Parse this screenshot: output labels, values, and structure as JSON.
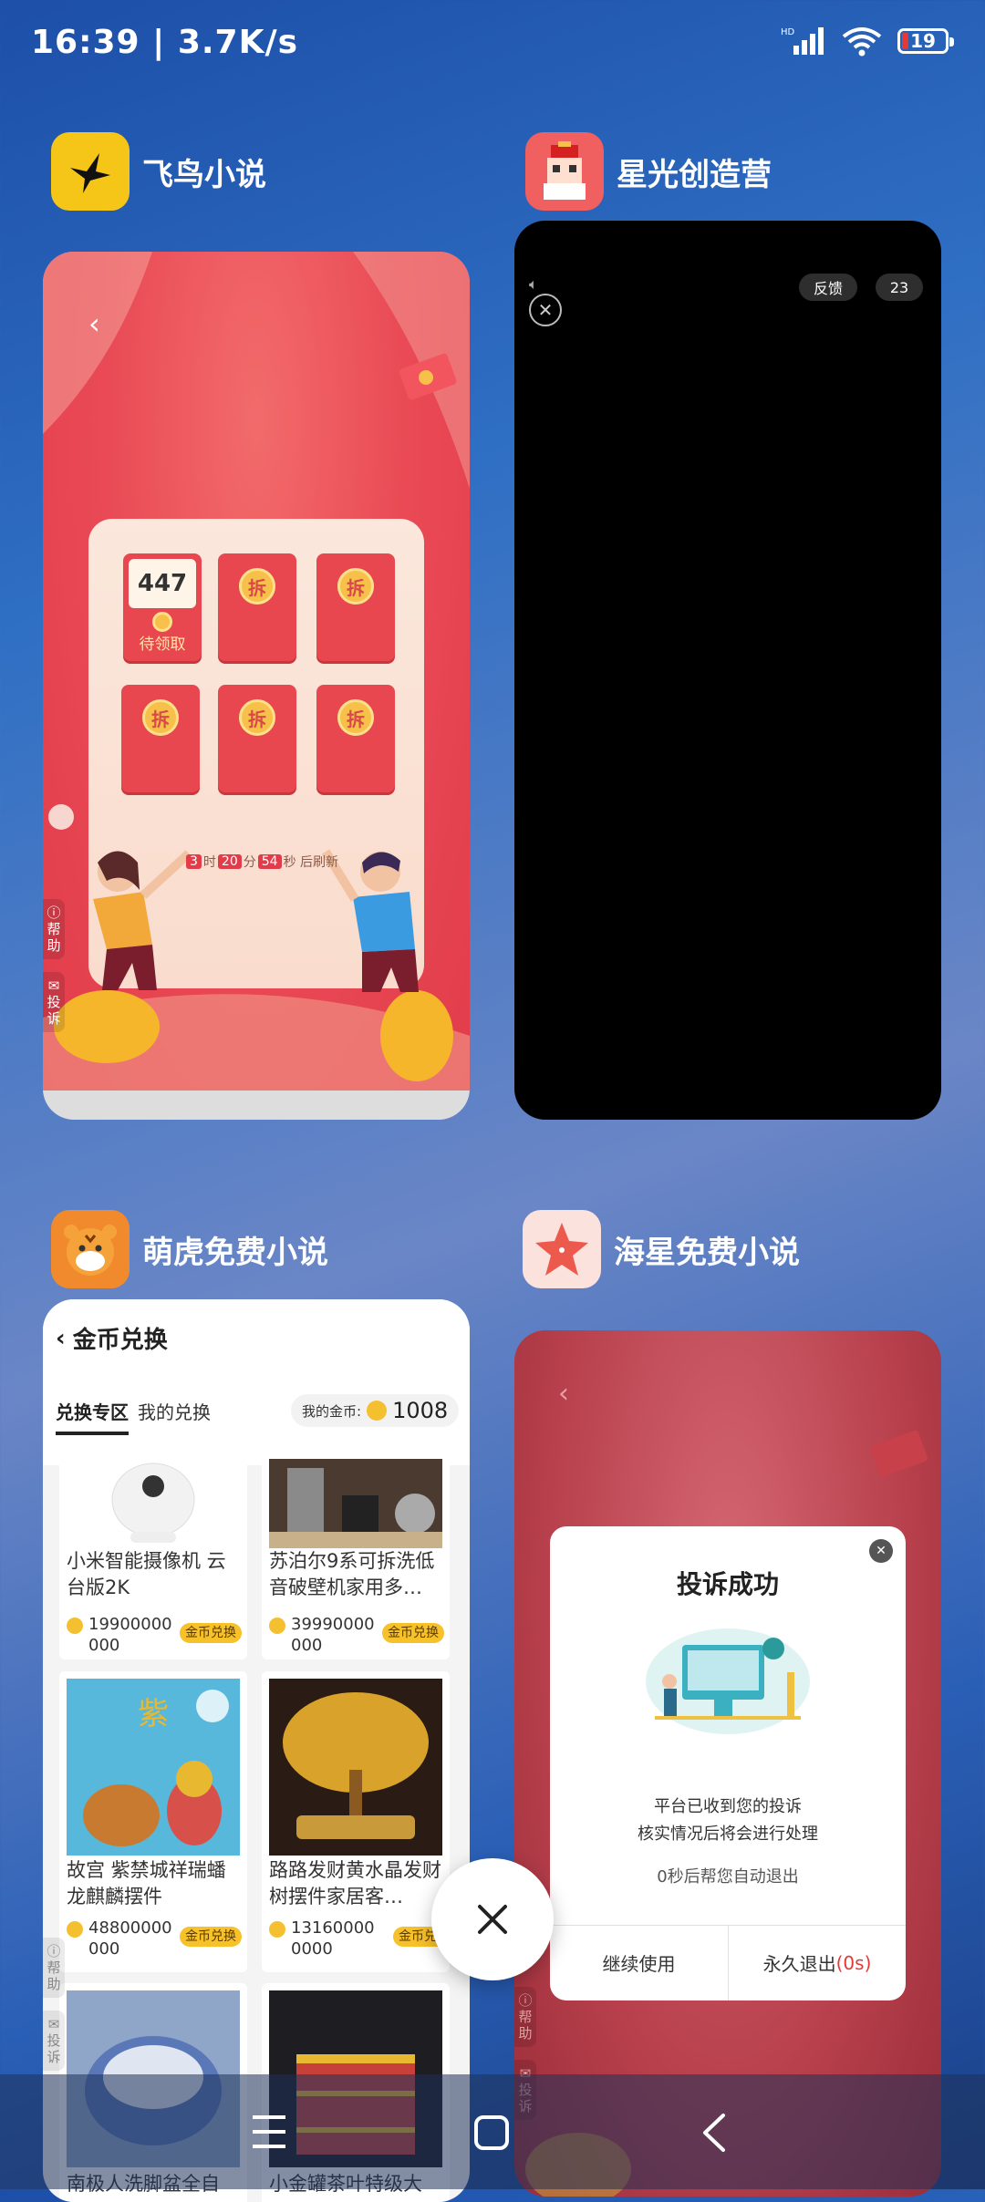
{
  "status_bar": {
    "time": "16:39",
    "speed": "3.7K/s",
    "network": "HD",
    "battery": "19"
  },
  "apps": [
    {
      "name": "飞鸟小说",
      "icon": "bird-icon",
      "accent": "#f5c518"
    },
    {
      "name": "星光创造营",
      "icon": "pixel-avatar-icon",
      "accent": "#f06060"
    },
    {
      "name": "萌虎免费小说",
      "icon": "tiger-icon",
      "accent": "#f08a2c"
    },
    {
      "name": "海星免费小说",
      "icon": "starfish-icon",
      "accent": "#f46a5e"
    }
  ],
  "card1": {
    "first_value": "447",
    "first_label": "待领取",
    "envelope_glyph": "拆",
    "timer": {
      "h": "3",
      "h_unit": "时",
      "m": "20",
      "m_unit": "分",
      "s": "54",
      "suffix": "秒 后刷新"
    },
    "help": "帮助",
    "complain": "投诉"
  },
  "card2": {
    "feedback": "反馈",
    "countdown": "23"
  },
  "card3": {
    "title": "金币兑换",
    "tab_active": "兑换专区",
    "tab_other": "我的兑换",
    "coins_label": "我的金币:",
    "coins_value": "1008",
    "tag": "金币兑换",
    "products": [
      {
        "name": "小米智能摄像机 云台版2K",
        "price": "19900000000"
      },
      {
        "name": "苏泊尔9系可拆洗低音破壁机家用多…",
        "price": "39990000000"
      },
      {
        "name": "故宫 紫禁城祥瑞蟠龙麒麟摆件",
        "price": "48800000000"
      },
      {
        "name": "路路发财黄水晶发财树摆件家居客…",
        "price": "131600000000"
      },
      {
        "name": "南极人洗脚盆全自",
        "price": ""
      },
      {
        "name": "小金罐茶叶特级大",
        "price": ""
      }
    ],
    "help": "帮助",
    "complain": "投诉"
  },
  "card4": {
    "dialog_title": "投诉成功",
    "line1": "平台已收到您的投诉",
    "line2": "核实情况后将会进行处理",
    "auto_exit": "0秒后帮您自动退出",
    "continue_btn": "继续使用",
    "exit_btn": "永久退出",
    "exit_count": "(0s)",
    "help": "帮助",
    "complain": "投诉"
  },
  "colors": {
    "red_envelope": "#e8474f",
    "coin": "#f6c04a",
    "exit_red": "#e53935"
  }
}
